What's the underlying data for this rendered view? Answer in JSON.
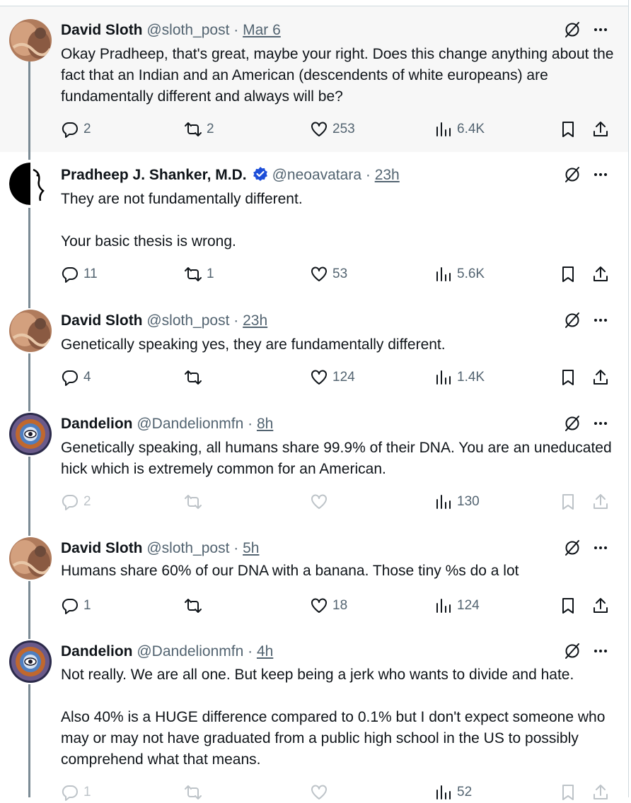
{
  "tweets": [
    {
      "name": "David Sloth",
      "handle": "@sloth_post",
      "time": "Mar 6",
      "sep": "·",
      "text": "Okay Pradheep, that's great, maybe your right. Does this change anything about the fact that an Indian and an American (descendents of white europeans) are fundamentally different and always will be?",
      "replies": "2",
      "reposts": "2",
      "likes": "253",
      "views": "6.4K",
      "avatar": "sloth-avatar"
    },
    {
      "name": "Pradheep J. Shanker, M.D.",
      "handle": "@neoavatara",
      "time": "23h",
      "sep": "·",
      "text": "They are not fundamentally different.\n\nYour basic thesis is wrong.",
      "replies": "11",
      "reposts": "1",
      "likes": "53",
      "views": "5.6K",
      "verified": true,
      "avatar": "neoavatara-avatar"
    },
    {
      "name": "David Sloth",
      "handle": "@sloth_post",
      "time": "23h",
      "sep": "·",
      "text": "Genetically speaking yes, they are fundamentally different.",
      "replies": "4",
      "reposts": "",
      "likes": "124",
      "views": "1.4K",
      "avatar": "sloth-avatar"
    },
    {
      "name": "Dandelion",
      "handle": "@Dandelionmfn",
      "time": "8h",
      "sep": "·",
      "text": "Genetically speaking, all humans share 99.9% of their DNA. You are an uneducated hick which is extremely common for an American.",
      "replies": "2",
      "reposts": "",
      "likes": "",
      "views": "130",
      "avatar": "dandelion-avatar",
      "faded": true
    },
    {
      "name": "David Sloth",
      "handle": "@sloth_post",
      "time": "5h",
      "sep": "·",
      "text": "Humans share 60% of our DNA with a banana. Those tiny %s do a lot",
      "replies": "1",
      "reposts": "",
      "likes": "18",
      "views": "124",
      "avatar": "sloth-avatar"
    },
    {
      "name": "Dandelion",
      "handle": "@Dandelionmfn",
      "time": "4h",
      "sep": "·",
      "text": "Not really. We are all one. But keep being a jerk who wants to divide and hate.\n\nAlso 40% is a HUGE difference compared to 0.1% but I don't expect someone who may or may not have graduated from a public high school in the US to possibly comprehend what that means.",
      "replies": "1",
      "reposts": "",
      "likes": "",
      "views": "52",
      "avatar": "dandelion-avatar",
      "faded": true
    }
  ],
  "colors": {
    "accent": "#1d9bf0",
    "verified": "#1d4ed8",
    "text": "#0f1419",
    "muted": "#536471",
    "thread": "#7b8b95"
  }
}
